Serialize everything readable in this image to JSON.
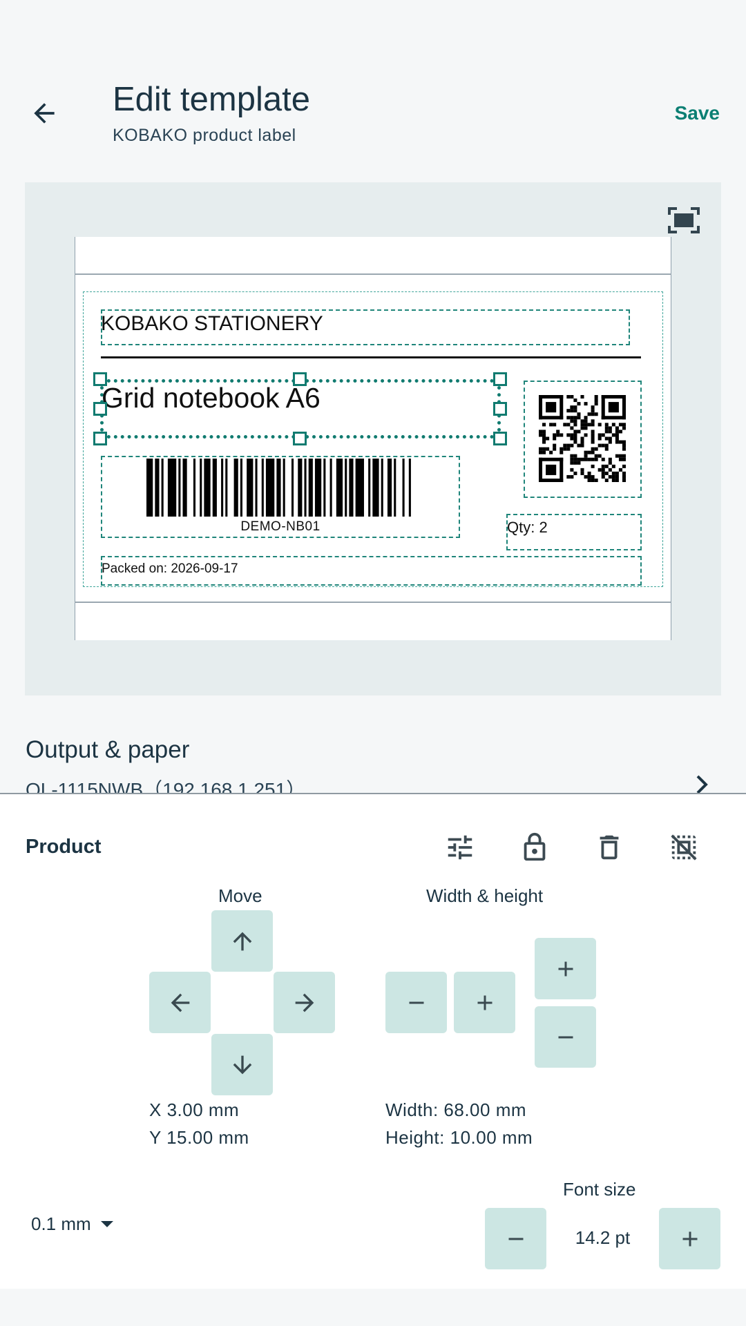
{
  "header": {
    "title": "Edit template",
    "subtitle": "KOBAKO product label",
    "save_label": "Save",
    "back_icon": "arrow-back-icon"
  },
  "canvas": {
    "fit_icon": "fit-screen-icon",
    "label": {
      "brand": "KOBAKO STATIONERY",
      "product": "Grid notebook A6",
      "barcode_text": "DEMO-NB01",
      "qty": "Qty: 2",
      "packed": "Packed on: 2026-09-17"
    }
  },
  "output": {
    "title": "Output & paper",
    "printer": "QL-1115NWB（192.168.1.251）"
  },
  "panel": {
    "title": "Product",
    "tools": [
      "tune-icon",
      "lock-icon",
      "delete-icon",
      "deselect-icon"
    ],
    "move": {
      "label": "Move",
      "x": "X 3.00 mm",
      "y": "Y 15.00 mm"
    },
    "size": {
      "label": "Width & height",
      "width": "Width: 68.00 mm",
      "height": "Height: 10.00 mm"
    },
    "step": "0.1 mm",
    "font": {
      "label": "Font size",
      "value": "14.2 pt"
    }
  },
  "colors": {
    "accent": "#0b7f73",
    "button_bg": "#cce6e3",
    "text": "#1c3443"
  }
}
